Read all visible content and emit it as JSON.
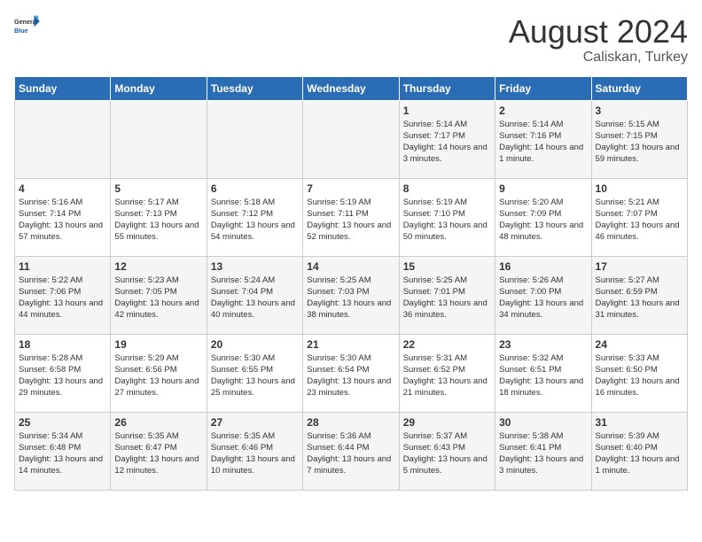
{
  "header": {
    "logo_general": "General",
    "logo_blue": "Blue",
    "title": "August 2024",
    "subtitle": "Caliskan, Turkey"
  },
  "days_of_week": [
    "Sunday",
    "Monday",
    "Tuesday",
    "Wednesday",
    "Thursday",
    "Friday",
    "Saturday"
  ],
  "weeks": [
    [
      {
        "num": "",
        "info": ""
      },
      {
        "num": "",
        "info": ""
      },
      {
        "num": "",
        "info": ""
      },
      {
        "num": "",
        "info": ""
      },
      {
        "num": "1",
        "info": "Sunrise: 5:14 AM\nSunset: 7:17 PM\nDaylight: 14 hours\nand 3 minutes."
      },
      {
        "num": "2",
        "info": "Sunrise: 5:14 AM\nSunset: 7:16 PM\nDaylight: 14 hours\nand 1 minute."
      },
      {
        "num": "3",
        "info": "Sunrise: 5:15 AM\nSunset: 7:15 PM\nDaylight: 13 hours\nand 59 minutes."
      }
    ],
    [
      {
        "num": "4",
        "info": "Sunrise: 5:16 AM\nSunset: 7:14 PM\nDaylight: 13 hours\nand 57 minutes."
      },
      {
        "num": "5",
        "info": "Sunrise: 5:17 AM\nSunset: 7:13 PM\nDaylight: 13 hours\nand 55 minutes."
      },
      {
        "num": "6",
        "info": "Sunrise: 5:18 AM\nSunset: 7:12 PM\nDaylight: 13 hours\nand 54 minutes."
      },
      {
        "num": "7",
        "info": "Sunrise: 5:19 AM\nSunset: 7:11 PM\nDaylight: 13 hours\nand 52 minutes."
      },
      {
        "num": "8",
        "info": "Sunrise: 5:19 AM\nSunset: 7:10 PM\nDaylight: 13 hours\nand 50 minutes."
      },
      {
        "num": "9",
        "info": "Sunrise: 5:20 AM\nSunset: 7:09 PM\nDaylight: 13 hours\nand 48 minutes."
      },
      {
        "num": "10",
        "info": "Sunrise: 5:21 AM\nSunset: 7:07 PM\nDaylight: 13 hours\nand 46 minutes."
      }
    ],
    [
      {
        "num": "11",
        "info": "Sunrise: 5:22 AM\nSunset: 7:06 PM\nDaylight: 13 hours\nand 44 minutes."
      },
      {
        "num": "12",
        "info": "Sunrise: 5:23 AM\nSunset: 7:05 PM\nDaylight: 13 hours\nand 42 minutes."
      },
      {
        "num": "13",
        "info": "Sunrise: 5:24 AM\nSunset: 7:04 PM\nDaylight: 13 hours\nand 40 minutes."
      },
      {
        "num": "14",
        "info": "Sunrise: 5:25 AM\nSunset: 7:03 PM\nDaylight: 13 hours\nand 38 minutes."
      },
      {
        "num": "15",
        "info": "Sunrise: 5:25 AM\nSunset: 7:01 PM\nDaylight: 13 hours\nand 36 minutes."
      },
      {
        "num": "16",
        "info": "Sunrise: 5:26 AM\nSunset: 7:00 PM\nDaylight: 13 hours\nand 34 minutes."
      },
      {
        "num": "17",
        "info": "Sunrise: 5:27 AM\nSunset: 6:59 PM\nDaylight: 13 hours\nand 31 minutes."
      }
    ],
    [
      {
        "num": "18",
        "info": "Sunrise: 5:28 AM\nSunset: 6:58 PM\nDaylight: 13 hours\nand 29 minutes."
      },
      {
        "num": "19",
        "info": "Sunrise: 5:29 AM\nSunset: 6:56 PM\nDaylight: 13 hours\nand 27 minutes."
      },
      {
        "num": "20",
        "info": "Sunrise: 5:30 AM\nSunset: 6:55 PM\nDaylight: 13 hours\nand 25 minutes."
      },
      {
        "num": "21",
        "info": "Sunrise: 5:30 AM\nSunset: 6:54 PM\nDaylight: 13 hours\nand 23 minutes."
      },
      {
        "num": "22",
        "info": "Sunrise: 5:31 AM\nSunset: 6:52 PM\nDaylight: 13 hours\nand 21 minutes."
      },
      {
        "num": "23",
        "info": "Sunrise: 5:32 AM\nSunset: 6:51 PM\nDaylight: 13 hours\nand 18 minutes."
      },
      {
        "num": "24",
        "info": "Sunrise: 5:33 AM\nSunset: 6:50 PM\nDaylight: 13 hours\nand 16 minutes."
      }
    ],
    [
      {
        "num": "25",
        "info": "Sunrise: 5:34 AM\nSunset: 6:48 PM\nDaylight: 13 hours\nand 14 minutes."
      },
      {
        "num": "26",
        "info": "Sunrise: 5:35 AM\nSunset: 6:47 PM\nDaylight: 13 hours\nand 12 minutes."
      },
      {
        "num": "27",
        "info": "Sunrise: 5:35 AM\nSunset: 6:46 PM\nDaylight: 13 hours\nand 10 minutes."
      },
      {
        "num": "28",
        "info": "Sunrise: 5:36 AM\nSunset: 6:44 PM\nDaylight: 13 hours\nand 7 minutes."
      },
      {
        "num": "29",
        "info": "Sunrise: 5:37 AM\nSunset: 6:43 PM\nDaylight: 13 hours\nand 5 minutes."
      },
      {
        "num": "30",
        "info": "Sunrise: 5:38 AM\nSunset: 6:41 PM\nDaylight: 13 hours\nand 3 minutes."
      },
      {
        "num": "31",
        "info": "Sunrise: 5:39 AM\nSunset: 6:40 PM\nDaylight: 13 hours\nand 1 minute."
      }
    ]
  ]
}
